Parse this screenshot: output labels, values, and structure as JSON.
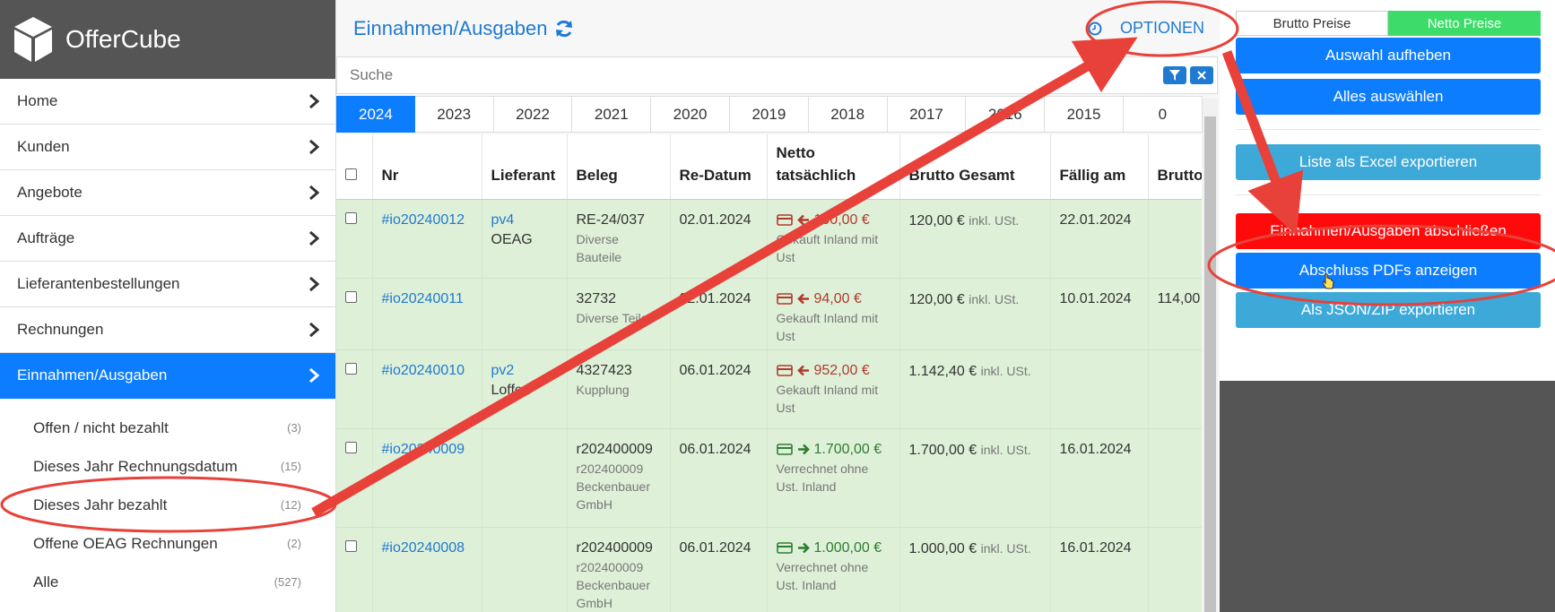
{
  "brand": {
    "name": "OfferCube"
  },
  "sidebar": {
    "items": [
      {
        "label": "Home"
      },
      {
        "label": "Kunden"
      },
      {
        "label": "Angebote"
      },
      {
        "label": "Aufträge"
      },
      {
        "label": "Lieferantenbestellungen"
      },
      {
        "label": "Rechnungen"
      },
      {
        "label": "Einnahmen/Ausgaben"
      }
    ],
    "subitems": [
      {
        "label": "Offen / nicht bezahlt",
        "count": "(3)"
      },
      {
        "label": "Dieses Jahr Rechnungsdatum",
        "count": "(15)"
      },
      {
        "label": "Dieses Jahr bezahlt",
        "count": "(12)"
      },
      {
        "label": "Offene OEAG Rechnungen",
        "count": "(2)"
      },
      {
        "label": "Alle",
        "count": "(527)"
      }
    ]
  },
  "main": {
    "title": "Einnahmen/Ausgaben",
    "options_label": "OPTIONEN",
    "search_placeholder": "Suche",
    "years": [
      "2024",
      "2023",
      "2022",
      "2021",
      "2020",
      "2019",
      "2018",
      "2017",
      "2016",
      "2015",
      "0"
    ]
  },
  "table": {
    "headers": {
      "nr": "Nr",
      "lieferant": "Lieferant",
      "beleg": "Beleg",
      "redatum": "Re-Datum",
      "netto_1": "Netto",
      "netto_2": "tatsächlich",
      "brutto": "Brutto Gesamt",
      "faellig": "Fällig am",
      "brutto2": "Brutto"
    },
    "rows": [
      {
        "nr": "#io20240012",
        "lieferant_link": "pv4",
        "lieferant_name": "OEAG",
        "beleg": "RE-24/037",
        "beleg_sub": "Diverse Bauteile",
        "datum": "02.01.2024",
        "netto": "100,00 €",
        "netto_sub": "Gekauft Inland mit Ust",
        "brutto": "120,00 €",
        "inkl": "inkl. USt.",
        "faellig": "22.01.2024",
        "brutto2": ""
      },
      {
        "nr": "#io20240011",
        "lieferant_link": "",
        "lieferant_name": "",
        "beleg": "32732",
        "beleg_sub": "Diverse Teile",
        "datum": "02.01.2024",
        "netto": "94,00 €",
        "netto_sub": "Gekauft Inland mit Ust",
        "brutto": "120,00 €",
        "inkl": "inkl. USt.",
        "faellig": "10.01.2024",
        "brutto2": "114,00"
      },
      {
        "nr": "#io20240010",
        "lieferant_link": "pv2",
        "lieferant_name": "Loffen",
        "beleg": "4327423",
        "beleg_sub": "Kupplung",
        "datum": "06.01.2024",
        "netto": "952,00 €",
        "netto_sub": "Gekauft Inland mit Ust",
        "brutto": "1.142,40 €",
        "inkl": "inkl. USt.",
        "faellig": "",
        "brutto2": ""
      },
      {
        "nr": "#io20240009",
        "lieferant_link": "",
        "lieferant_name": "",
        "beleg": "r202400009",
        "beleg_sub": "r202400009 Beckenbauer GmbH",
        "datum": "06.01.2024",
        "netto": "1.700,00 €",
        "netto_sub": "Verrechnet ohne Ust. Inland",
        "brutto": "1.700,00 €",
        "inkl": "inkl. USt.",
        "faellig": "16.01.2024",
        "brutto2": ""
      },
      {
        "nr": "#io20240008",
        "lieferant_link": "",
        "lieferant_name": "",
        "beleg": "r202400009",
        "beleg_sub": "r202400009 Beckenbauer GmbH",
        "datum": "06.01.2024",
        "netto": "1.000,00 €",
        "netto_sub": "Verrechnet ohne Ust. Inland",
        "brutto": "1.000,00 €",
        "inkl": "inkl. USt.",
        "faellig": "16.01.2024",
        "brutto2": ""
      }
    ]
  },
  "right_panel": {
    "brutto_label": "Brutto Preise",
    "netto_label": "Netto Preise",
    "deselect": "Auswahl aufheben",
    "select_all": "Alles auswählen",
    "export_excel": "Liste als Excel exportieren",
    "close_books": "Einnahmen/Ausgaben abschließen",
    "show_pdfs": "Abschluss PDFs anzeigen",
    "export_json": "Als JSON/ZIP exportieren"
  },
  "colors": {
    "accent": "#0d7dff",
    "sidebar_dark": "#555555",
    "row_green": "#dff0d8",
    "danger": "#ff0a0a",
    "annotation": "#e8413a"
  }
}
